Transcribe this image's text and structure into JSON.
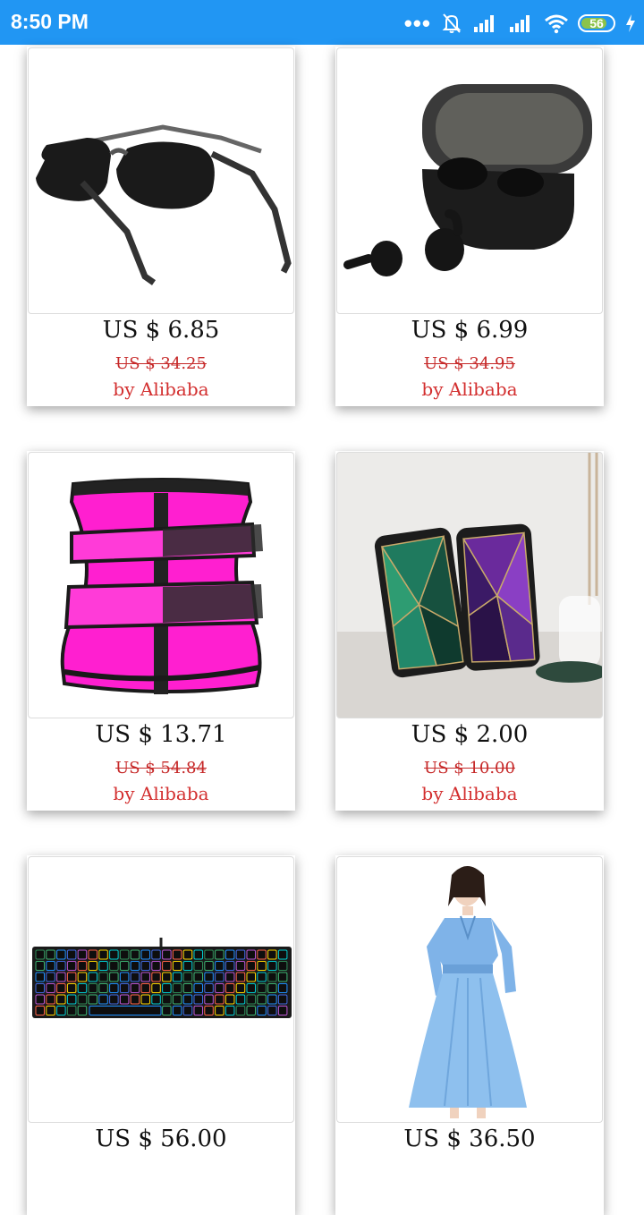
{
  "status_bar": {
    "time": "8:50 PM",
    "battery": "56"
  },
  "products": [
    {
      "price": "US $ 6.85",
      "original_price": "US $ 34.25",
      "seller": "by Alibaba",
      "image": "sunglasses"
    },
    {
      "price": "US $ 6.99",
      "original_price": "US $ 34.95",
      "seller": "by Alibaba",
      "image": "earbuds-case"
    },
    {
      "price": "US $ 13.71",
      "original_price": "US $ 54.84",
      "seller": "by Alibaba",
      "image": "waist-trainer"
    },
    {
      "price": "US $ 2.00",
      "original_price": "US $ 10.00",
      "seller": "by Alibaba",
      "image": "phone-cases"
    },
    {
      "price": "US $ 56.00",
      "original_price": "",
      "seller": "",
      "image": "rgb-keyboard"
    },
    {
      "price": "US $ 36.50",
      "original_price": "",
      "seller": "",
      "image": "blue-dress"
    }
  ]
}
